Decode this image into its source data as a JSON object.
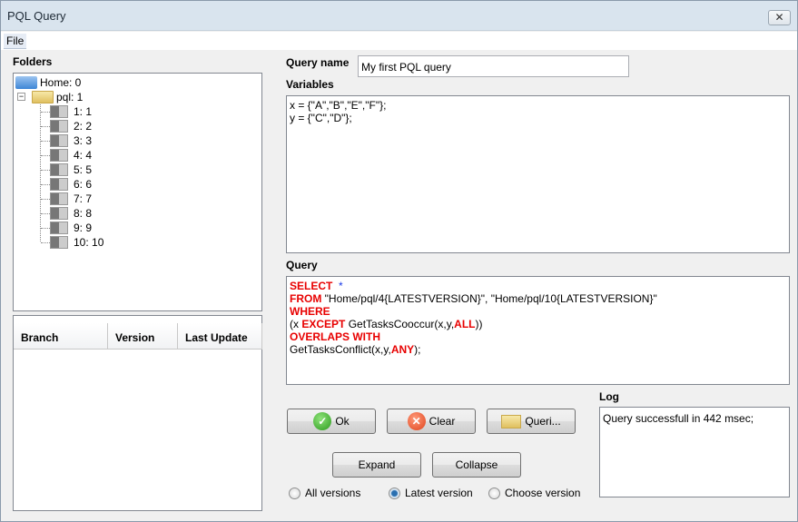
{
  "window": {
    "title": "PQL Query",
    "close": "✕"
  },
  "menu": {
    "file": "File"
  },
  "folders": {
    "label": "Folders",
    "home": "Home: 0",
    "pql": "pql: 1",
    "children": [
      "1: 1",
      "2: 2",
      "3: 3",
      "4: 4",
      "5: 5",
      "6: 6",
      "7: 7",
      "8: 8",
      "9: 9",
      "10: 10"
    ]
  },
  "table": {
    "columns": [
      "Branch",
      "Version",
      "Last Update"
    ]
  },
  "query_name": {
    "label": "Query name",
    "value": "My first PQL query"
  },
  "variables": {
    "label": "Variables",
    "lines": [
      "x = {\"A\",\"B\",\"E\",\"F\"};",
      "y = {\"C\",\"D\"};"
    ]
  },
  "query": {
    "label": "Query",
    "lines": [
      [
        {
          "t": "SELECT",
          "k": "kw"
        },
        {
          "t": "  *",
          "k": "op"
        }
      ],
      [
        {
          "t": "FROM",
          "k": "kw"
        },
        {
          "t": " \"Home/pql/4{LATESTVERSION}\", \"Home/pql/10{LATESTVERSION}\"",
          "k": "txt"
        }
      ],
      [
        {
          "t": "WHERE",
          "k": "kw"
        }
      ],
      [
        {
          "t": "(x ",
          "k": "txt"
        },
        {
          "t": "EXCEPT",
          "k": "kw"
        },
        {
          "t": " GetTasksCooccur(x,y,",
          "k": "txt"
        },
        {
          "t": "ALL",
          "k": "kw"
        },
        {
          "t": "))",
          "k": "txt"
        }
      ],
      [
        {
          "t": "OVERLAPS WITH",
          "k": "kw"
        }
      ],
      [
        {
          "t": "GetTasksConflict(x,y,",
          "k": "txt"
        },
        {
          "t": "ANY",
          "k": "kw"
        },
        {
          "t": ");",
          "k": "txt"
        }
      ]
    ]
  },
  "buttons": {
    "ok": "Ok",
    "clear": "Clear",
    "queries": "Queri...",
    "expand": "Expand",
    "collapse": "Collapse"
  },
  "radios": {
    "all": "All versions",
    "latest": "Latest version",
    "choose": "Choose version",
    "selected": "latest"
  },
  "log": {
    "label": "Log",
    "text": "Query successfull in 442 msec;"
  },
  "colors": {
    "keyword": "#e80000",
    "operator": "#1a3ae8"
  }
}
